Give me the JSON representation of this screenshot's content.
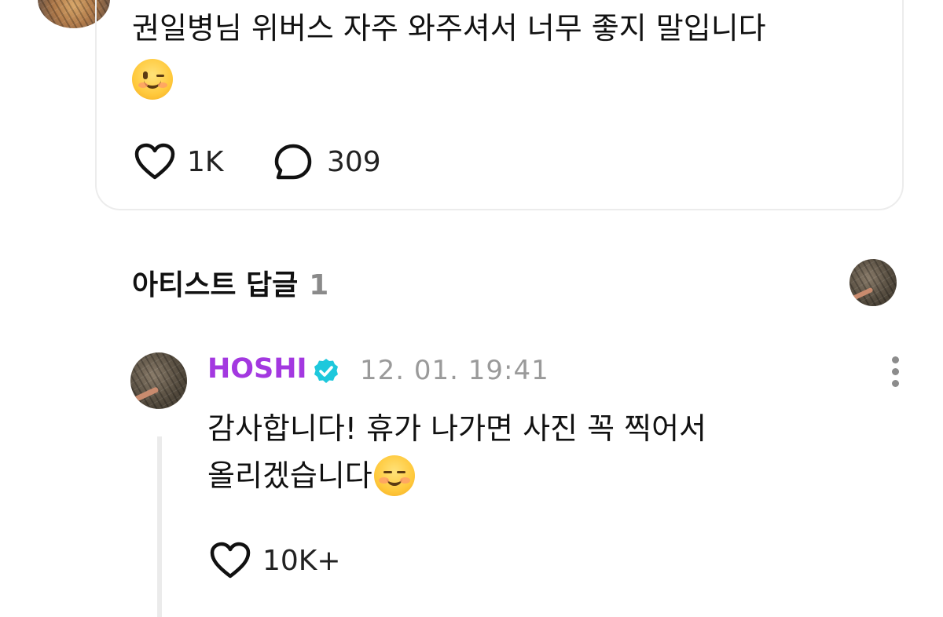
{
  "post": {
    "text": "권일병님 위버스 자주 와주셔서 너무 좋지 말입니다",
    "like_count": "1K",
    "comment_count": "309"
  },
  "section": {
    "title": "아티스트 답글",
    "count": "1"
  },
  "reply": {
    "author": "HOSHI",
    "timestamp": "12. 01. 19:41",
    "text_line1": "감사합니다! 휴가 나가면 사진 꼭 찍어서",
    "text_line2": "올리겠습니다",
    "like_count": "10K+"
  },
  "colors": {
    "artist_name": "#a338e0",
    "verified_badge": "#1ec8dc",
    "muted": "#9a9a9a"
  },
  "icons": [
    "heart-icon",
    "comment-bubble-icon",
    "verified-badge-icon",
    "more-options-icon",
    "wink-emoji",
    "smiling-blush-emoji"
  ]
}
